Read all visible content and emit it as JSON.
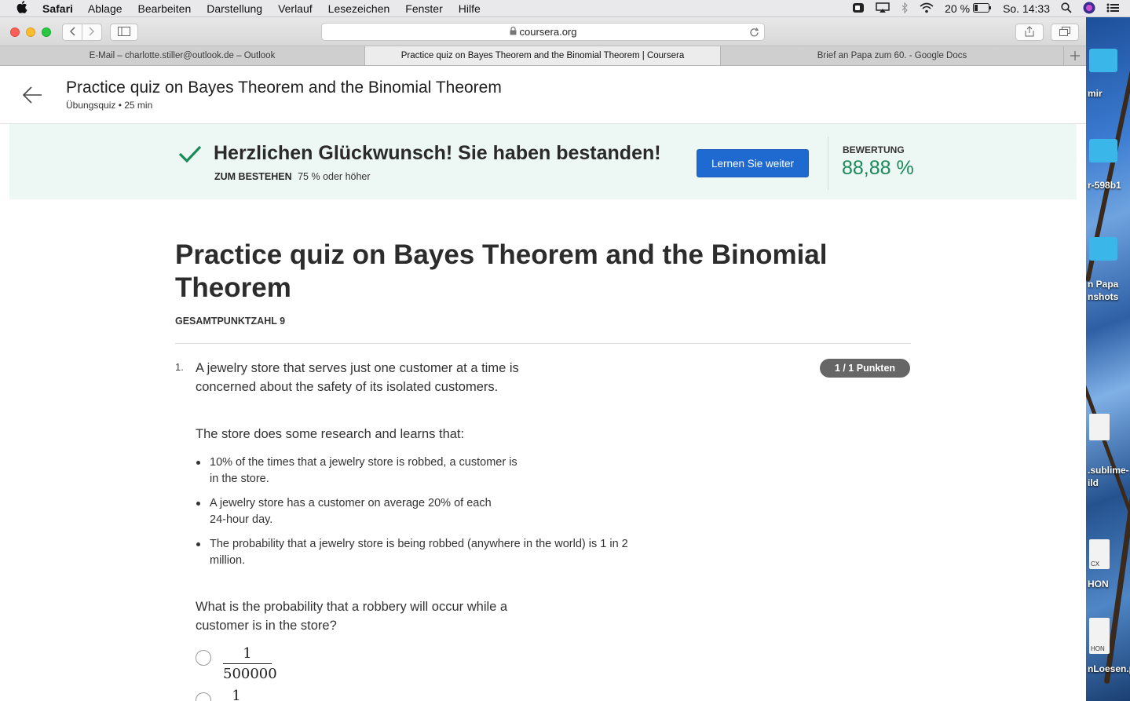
{
  "menubar": {
    "app_name": "Safari",
    "items": [
      "Ablage",
      "Bearbeiten",
      "Darstellung",
      "Verlauf",
      "Lesezeichen",
      "Fenster",
      "Hilfe"
    ],
    "battery": "20 %",
    "clock": "So. 14:33"
  },
  "browser": {
    "address": "coursera.org",
    "tabs": [
      {
        "label": "E-Mail – charlotte.stiller@outlook.de – Outlook",
        "active": false
      },
      {
        "label": "Practice quiz on Bayes Theorem and the Binomial Theorem | Coursera",
        "active": true
      },
      {
        "label": "Brief an Papa zum 60. - Google Docs",
        "active": false
      }
    ]
  },
  "header": {
    "title": "Practice quiz on Bayes Theorem and the Binomial Theorem",
    "subtitle": "Übungsquiz • 25 min"
  },
  "banner": {
    "message": "Herzlichen Glückwunsch! Sie haben bestanden!",
    "pass_label": "ZUM BESTEHEN",
    "pass_value": "75 % oder höher",
    "continue_label": "Lernen Sie weiter",
    "grade_label": "BEWERTUNG",
    "grade_value": "88,88 %",
    "accent_color": "#1b8a5a",
    "button_color": "#1f6ad0"
  },
  "quiz": {
    "title": "Practice quiz on Bayes Theorem and the Binomial Theorem",
    "total_points": "GESAMTPUNKTZAHL 9",
    "question": {
      "number": "1.",
      "points": "1 / 1 Punkten",
      "intro": "A jewelry store that serves just one customer at a time is concerned about the safety of its isolated customers.",
      "lead": "The store does some research and learns that:",
      "facts": [
        "10% of the times that a jewelry store is robbed, a customer is in the store.",
        "A jewelry store has a customer on average 20% of each 24-hour day.",
        "The probability that a jewelry store is being robbed (anywhere in the world) is 1 in 2 million."
      ],
      "prompt": "What is the probability that a robbery will occur while a customer is in the store?",
      "options": [
        {
          "numerator": "1",
          "denominator": "500000"
        },
        {
          "numerator": "1",
          "denominator": ""
        }
      ]
    }
  },
  "desktop": {
    "labels": [
      "mir",
      "r-598b1",
      "n Papa",
      "nshots",
      ".sublime-",
      "ild",
      "HON",
      "nLoesen.p"
    ],
    "file_tags": [
      "CX",
      "HON"
    ]
  }
}
